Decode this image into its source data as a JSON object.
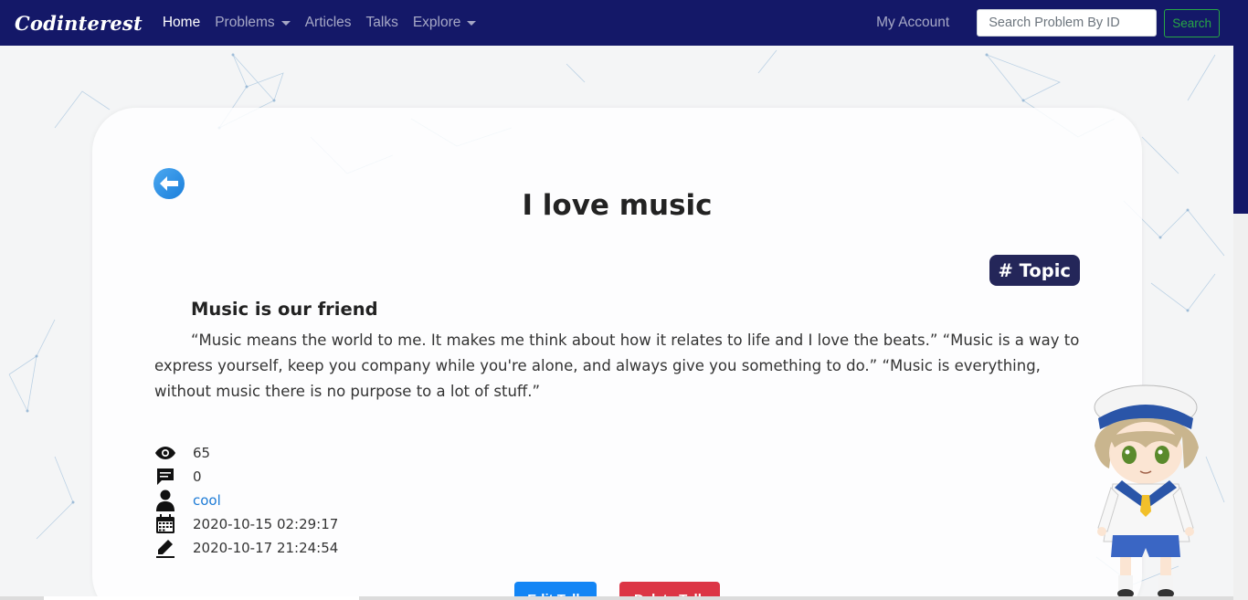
{
  "nav": {
    "brand": "Codinterest",
    "items": [
      {
        "label": "Home",
        "active": true,
        "dropdown": false
      },
      {
        "label": "Problems",
        "active": false,
        "dropdown": true
      },
      {
        "label": "Articles",
        "active": false,
        "dropdown": false
      },
      {
        "label": "Talks",
        "active": false,
        "dropdown": false
      },
      {
        "label": "Explore",
        "active": false,
        "dropdown": true
      }
    ],
    "account": "My Account",
    "search_placeholder": "Search Problem By ID",
    "search_button": "Search"
  },
  "talk": {
    "title": "I love music",
    "topic_badge": "# Topic",
    "subtitle": "Music is our friend",
    "body": "“Music means the world to me. It makes me think about how it relates to life and I love the beats.” “Music is a way to express yourself, keep you company while you're alone, and always give you something to do.” “Music is everything, without music there is no purpose to a lot of stuff.”",
    "views": "65",
    "comments": "0",
    "author": "cool",
    "created": "2020-10-15 02:29:17",
    "updated": "2020-10-17 21:24:54",
    "edit_label": "Edit Talk",
    "delete_label": "Delete Talk"
  },
  "colors": {
    "navbar": "#141868",
    "badge": "#242659",
    "edit": "#1385f5",
    "delete": "#dc3545",
    "search_outline": "#28a745"
  }
}
